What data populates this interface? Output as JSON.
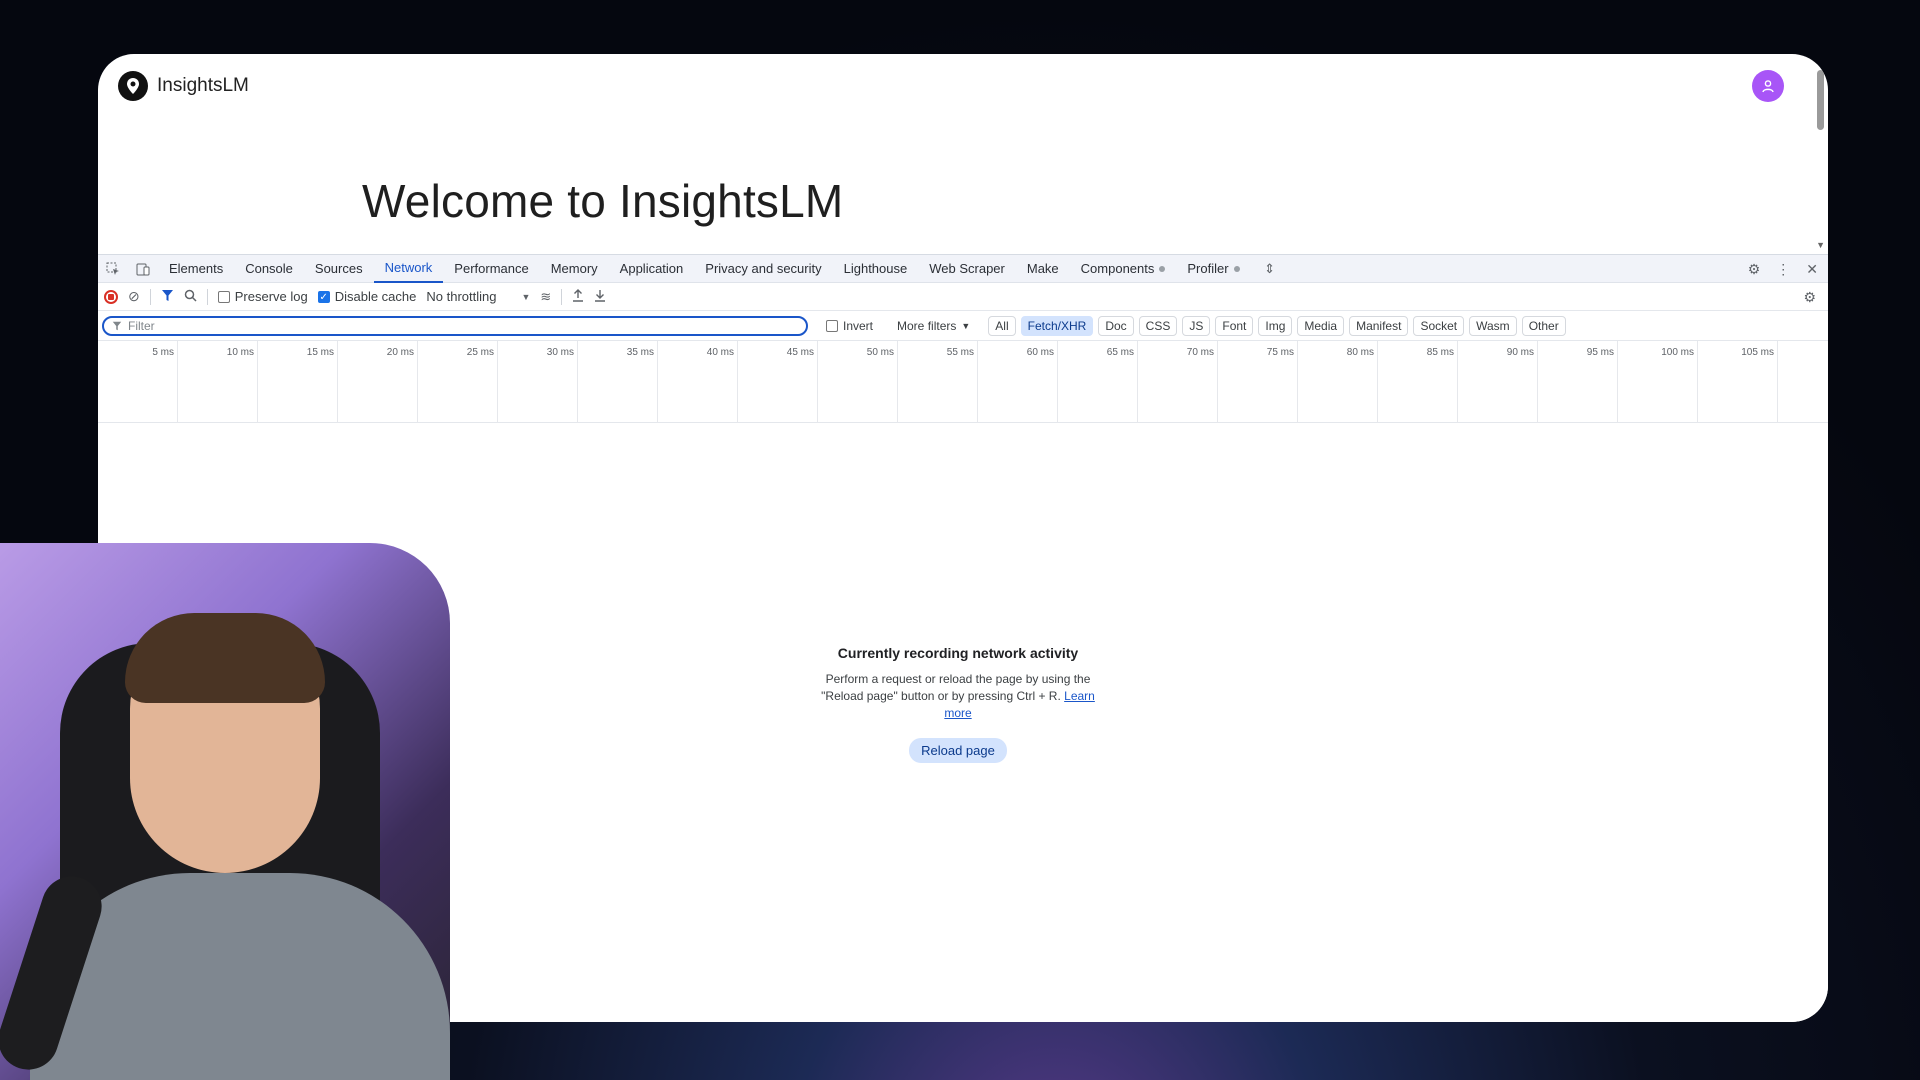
{
  "app": {
    "name": "InsightsLM",
    "welcome": "Welcome to InsightsLM"
  },
  "devtools": {
    "tabs": [
      {
        "label": "Elements"
      },
      {
        "label": "Console"
      },
      {
        "label": "Sources"
      },
      {
        "label": "Network",
        "active": true
      },
      {
        "label": "Performance"
      },
      {
        "label": "Memory"
      },
      {
        "label": "Application"
      },
      {
        "label": "Privacy and security"
      },
      {
        "label": "Lighthouse"
      },
      {
        "label": "Web Scraper"
      },
      {
        "label": "Make"
      },
      {
        "label": "Components",
        "dot": true
      },
      {
        "label": "Profiler",
        "dot": true
      }
    ],
    "toolbar": {
      "preserve_log": "Preserve log",
      "disable_cache": "Disable cache",
      "throttling": "No throttling"
    },
    "filter": {
      "placeholder": "Filter",
      "invert": "Invert",
      "more_filters": "More filters",
      "types": [
        "All",
        "Fetch/XHR",
        "Doc",
        "CSS",
        "JS",
        "Font",
        "Img",
        "Media",
        "Manifest",
        "Socket",
        "Wasm",
        "Other"
      ],
      "active_type": "Fetch/XHR"
    },
    "timeline_ticks": [
      "5 ms",
      "10 ms",
      "15 ms",
      "20 ms",
      "25 ms",
      "30 ms",
      "35 ms",
      "40 ms",
      "45 ms",
      "50 ms",
      "55 ms",
      "60 ms",
      "65 ms",
      "70 ms",
      "75 ms",
      "80 ms",
      "85 ms",
      "90 ms",
      "95 ms",
      "100 ms",
      "105 ms"
    ],
    "empty_state": {
      "title": "Currently recording network activity",
      "description": "Perform a request or reload the page by using the \"Reload page\" button or by pressing Ctrl + R.",
      "link": "Learn more",
      "button": "Reload page"
    }
  },
  "colors": {
    "accent": "#1a56c9",
    "avatar": "#a855f7",
    "record": "#d93025"
  }
}
